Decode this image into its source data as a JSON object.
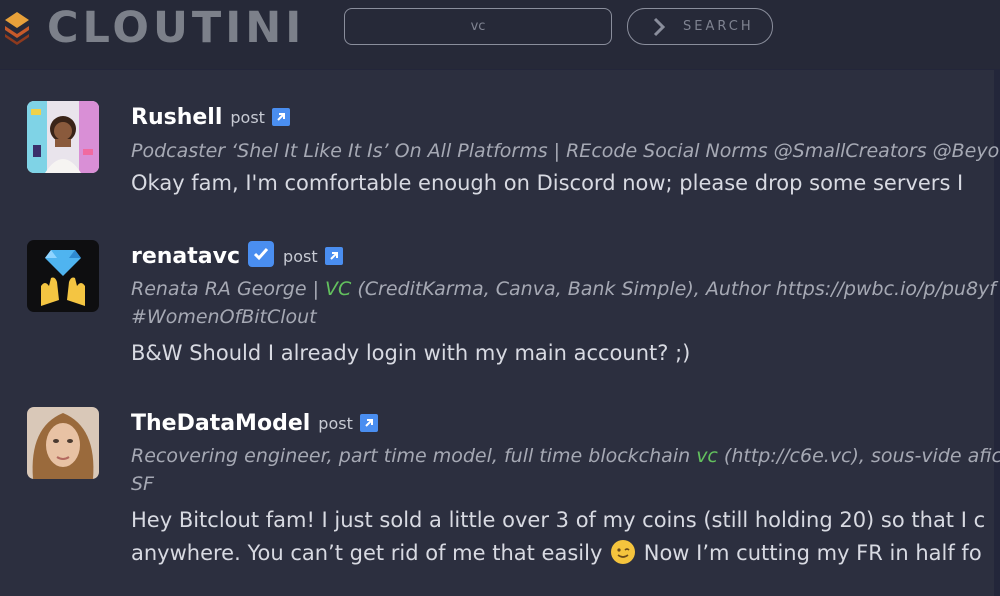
{
  "app": {
    "logo_text": "CLOUTINI"
  },
  "search": {
    "value": "vc",
    "button_label": "SEARCH"
  },
  "posts": [
    {
      "username": "Rushell",
      "verified": false,
      "post_label": "post",
      "bio_parts": [
        "Podcaster ‘Shel It Like It Is’ On All Platforms | REcode Social Norms @SmallCreators @Beyo"
      ],
      "body_lines": [
        "Okay fam, I'm comfortable enough on Discord now; please drop some servers I"
      ]
    },
    {
      "username": "renatavc",
      "verified": true,
      "post_label": "post",
      "bio_line1_pre": "Renata RA George | ",
      "bio_line1_hl": "VC",
      "bio_line1_post": " (CreditKarma, Canva, Bank Simple), Author https://pwbc.io/p/pu8yf",
      "bio_line2": "#WomenOfBitClout",
      "body_lines": [
        "B&W Should I already login with my main account? ;)"
      ]
    },
    {
      "username": "TheDataModel",
      "verified": false,
      "post_label": "post",
      "bio_line1_pre": "Recovering engineer, part time model, full time blockchain ",
      "bio_line1_hl": "vc",
      "bio_line1_post": " (http://c6e.vc), sous-vide afic",
      "bio_line2": "SF",
      "body_line1": "Hey Bitclout fam! I just sold a little over 3 of my coins (still holding 20) so that I c",
      "body_line2_pre": "anywhere. You can’t get rid of me that easily ",
      "body_line2_post": " Now I’m cutting my FR in half fo"
    }
  ],
  "colors": {
    "background": "#2c2f3f",
    "topbar": "#262938",
    "accent_blue": "#4a8ef0",
    "highlight_green": "#63c15e",
    "logo_gray": "#7c808a"
  },
  "icons": [
    "logo-icon",
    "chevron-right-icon",
    "verified-check-icon",
    "external-link-icon",
    "winking-face-icon"
  ]
}
